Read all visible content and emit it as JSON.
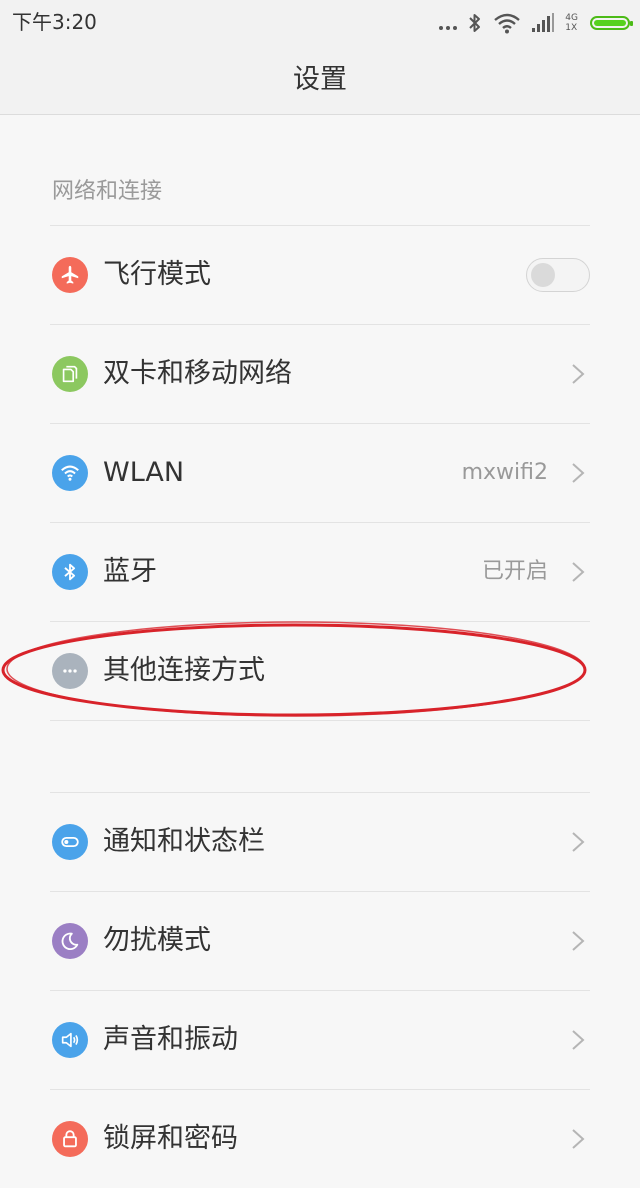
{
  "status_bar": {
    "time": "下午3:20",
    "network_top": "4G",
    "network_bottom": "1X",
    "battery_level": 1.0,
    "battery_color": "#56d11e"
  },
  "header": {
    "title": "设置"
  },
  "sections": {
    "network": {
      "title": "网络和连接",
      "items": {
        "airplane": {
          "label": "飞行模式",
          "enabled": false,
          "color": "#f46b5a",
          "icon": "airplane-icon"
        },
        "sim": {
          "label": "双卡和移动网络",
          "color": "#8cc860",
          "icon": "sim-card-icon"
        },
        "wlan": {
          "label": "WLAN",
          "value": "mxwifi2",
          "color": "#4aa3ea",
          "icon": "wifi-icon"
        },
        "bluetooth": {
          "label": "蓝牙",
          "value": "已开启",
          "color": "#4aa3ea",
          "icon": "bluetooth-icon"
        },
        "other": {
          "label": "其他连接方式",
          "color": "#aab3bd",
          "icon": "more-dots-icon"
        }
      }
    },
    "system": {
      "items": {
        "notification": {
          "label": "通知和状态栏",
          "color": "#4aa3ea",
          "icon": "notification-toggle-icon"
        },
        "dnd": {
          "label": "勿扰模式",
          "color": "#9b7fc4",
          "icon": "moon-icon"
        },
        "sound": {
          "label": "声音和振动",
          "color": "#4aa3ea",
          "icon": "speaker-icon"
        },
        "lock": {
          "label": "锁屏和密码",
          "color": "#f46b5a",
          "icon": "lock-icon"
        }
      }
    }
  },
  "annotation": {
    "shape": "ellipse",
    "color": "#d8232a"
  }
}
